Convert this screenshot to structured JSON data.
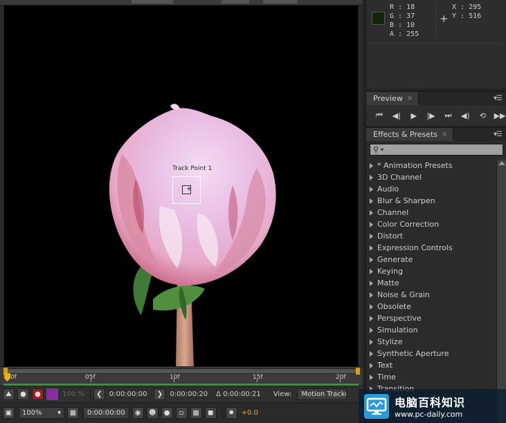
{
  "info": {
    "r": "R : 18",
    "g": "G : 37",
    "b": "B : 10",
    "a": "A : 255",
    "x": "X : 295",
    "y": "Y : 516",
    "swatch_color": "#12250a"
  },
  "preview": {
    "tab_label": "Preview",
    "controls": [
      "first-frame-icon",
      "previous-frame-icon",
      "play-icon",
      "next-frame-icon",
      "last-frame-icon",
      "audio-icon",
      "loop-icon",
      "ram-preview-icon"
    ]
  },
  "effects": {
    "tab_label": "Effects & Presets",
    "search_placeholder": "",
    "items": [
      "* Animation Presets",
      "3D Channel",
      "Audio",
      "Blur & Sharpen",
      "Channel",
      "Color Correction",
      "Distort",
      "Expression Controls",
      "Generate",
      "Keying",
      "Matte",
      "Noise & Grain",
      "Obsolete",
      "Perspective",
      "Simulation",
      "Stylize",
      "Synthetic Aperture",
      "Text",
      "Time",
      "Transition"
    ]
  },
  "viewer": {
    "track_point_label": "Track Point 1",
    "ruler_labels": [
      "0f",
      "05f",
      "10f",
      "15f",
      "20f"
    ]
  },
  "footer": {
    "opacity_value": "100 %",
    "timecode_start": "0:00:00:00",
    "timecode_end": "0:00:00:20",
    "timecode_duration": "Δ 0:00:00:21",
    "view_label": "View:",
    "view_value": "Motion Tracker",
    "zoom_value": "100%",
    "current_time": "0:00:00:00",
    "exposure_value": "+0.0"
  },
  "watermark": {
    "cn_text": "电脑百科知识",
    "url_text": "www.pc-daily.com"
  },
  "colors": {
    "playhead": "#e3b21c",
    "work_area_green": "#2f9a2f",
    "exposure": "#e0b020"
  }
}
